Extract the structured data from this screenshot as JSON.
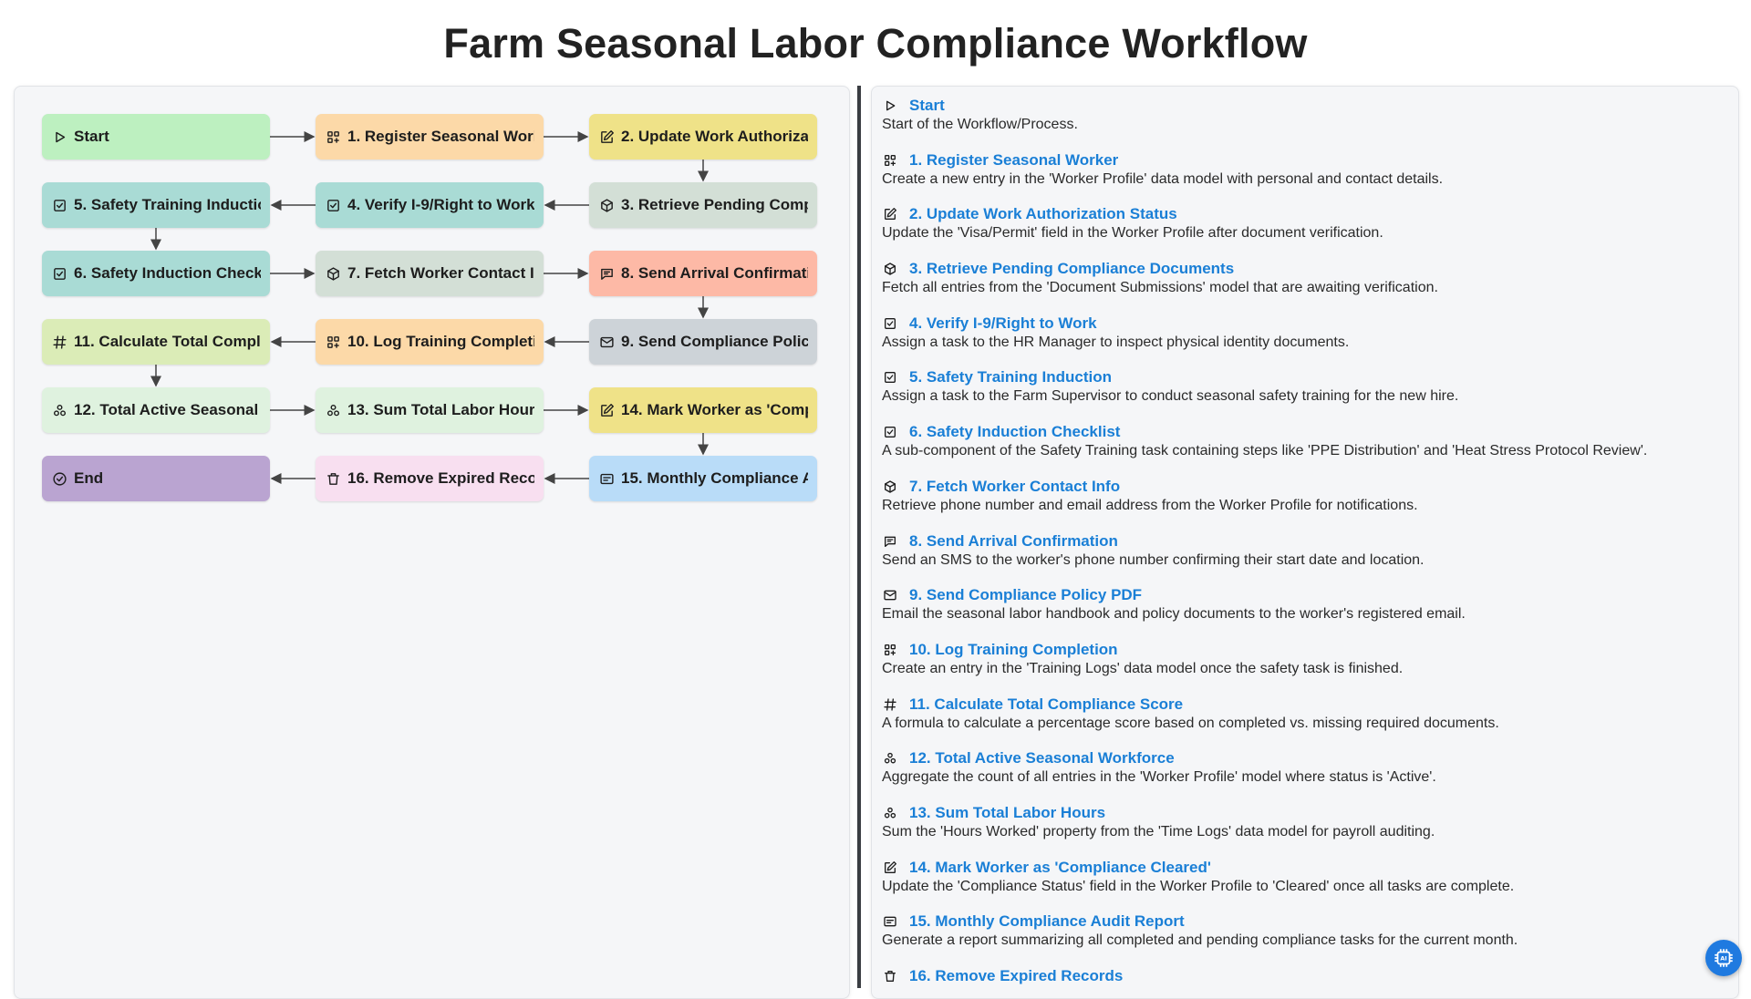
{
  "title": "Farm Seasonal Labor Compliance Workflow",
  "colors": {
    "start": "#bdf0c0",
    "register": "#fcd9a8",
    "update": "#efe288",
    "retrieve": "#d3dfd6",
    "verify": "#a9dbd5",
    "send_sms": "#fdb9a6",
    "send_email": "#cdd3d8",
    "formula": "#dbecb7",
    "aggregate": "#dff2df",
    "report": "#b9dcf8",
    "delete": "#f8dff0",
    "end": "#baa4d1",
    "link": "#1a7fd6",
    "edge": "#444444"
  },
  "nodes": [
    {
      "label": "Start",
      "icon": "play-icon",
      "color": "start"
    },
    {
      "label": "1. Register Seasonal Worker",
      "icon": "grid-icon",
      "color": "register"
    },
    {
      "label": "2. Update Work Authorization Status",
      "icon": "edit-icon",
      "color": "update"
    },
    {
      "label": "3. Retrieve Pending Compliance Documents",
      "icon": "cube-icon",
      "color": "retrieve"
    },
    {
      "label": "4. Verify I-9/Right to Work",
      "icon": "checkbox-icon",
      "color": "verify"
    },
    {
      "label": "5. Safety Training Induction",
      "icon": "checkbox-icon",
      "color": "verify"
    },
    {
      "label": "6. Safety Induction Checklist",
      "icon": "checkbox-icon",
      "color": "verify"
    },
    {
      "label": "7. Fetch Worker Contact Info",
      "icon": "cube-icon",
      "color": "retrieve"
    },
    {
      "label": "8. Send Arrival Confirmation",
      "icon": "chat-icon",
      "color": "send_sms"
    },
    {
      "label": "9. Send Compliance Policy PDF",
      "icon": "mail-icon",
      "color": "send_email"
    },
    {
      "label": "10. Log Training Completion",
      "icon": "grid-icon",
      "color": "register"
    },
    {
      "label": "11. Calculate Total Compliance Score",
      "icon": "hash-icon",
      "color": "formula"
    },
    {
      "label": "12. Total Active Seasonal Workforce",
      "icon": "aggregate-icon",
      "color": "aggregate"
    },
    {
      "label": "13. Sum Total Labor Hours",
      "icon": "aggregate-icon",
      "color": "aggregate"
    },
    {
      "label": "14. Mark Worker as 'Compliance Cleared'",
      "icon": "edit-icon",
      "color": "update"
    },
    {
      "label": "15. Monthly Compliance Audit Report",
      "icon": "report-icon",
      "color": "report"
    },
    {
      "label": "16. Remove Expired Records",
      "icon": "trash-icon",
      "color": "delete"
    },
    {
      "label": "End",
      "icon": "check-circle-icon",
      "color": "end"
    }
  ],
  "steps": [
    {
      "title": "Start",
      "icon": "play-icon",
      "desc": "Start of the Workflow/Process."
    },
    {
      "title": "1. Register Seasonal Worker",
      "icon": "grid-icon",
      "desc": "Create a new entry in the 'Worker Profile' data model with personal and contact details."
    },
    {
      "title": "2. Update Work Authorization Status",
      "icon": "edit-icon",
      "desc": "Update the 'Visa/Permit' field in the Worker Profile after document verification."
    },
    {
      "title": "3. Retrieve Pending Compliance Documents",
      "icon": "cube-icon",
      "desc": "Fetch all entries from the 'Document Submissions' model that are awaiting verification."
    },
    {
      "title": "4. Verify I-9/Right to Work",
      "icon": "checkbox-icon",
      "desc": "Assign a task to the HR Manager to inspect physical identity documents."
    },
    {
      "title": "5. Safety Training Induction",
      "icon": "checkbox-icon",
      "desc": "Assign a task to the Farm Supervisor to conduct seasonal safety training for the new hire."
    },
    {
      "title": "6. Safety Induction Checklist",
      "icon": "checkbox-icon",
      "desc": "A sub-component of the Safety Training task containing steps like 'PPE Distribution' and 'Heat Stress Protocol Review'."
    },
    {
      "title": "7. Fetch Worker Contact Info",
      "icon": "cube-icon",
      "desc": "Retrieve phone number and email address from the Worker Profile for notifications."
    },
    {
      "title": "8. Send Arrival Confirmation",
      "icon": "chat-icon",
      "desc": "Send an SMS to the worker's phone number confirming their start date and location."
    },
    {
      "title": "9. Send Compliance Policy PDF",
      "icon": "mail-icon",
      "desc": "Email the seasonal labor handbook and policy documents to the worker's registered email."
    },
    {
      "title": "10. Log Training Completion",
      "icon": "grid-icon",
      "desc": "Create an entry in the 'Training Logs' data model once the safety task is finished."
    },
    {
      "title": "11. Calculate Total Compliance Score",
      "icon": "hash-icon",
      "desc": "A formula to calculate a percentage score based on completed vs. missing required documents."
    },
    {
      "title": "12. Total Active Seasonal Workforce",
      "icon": "aggregate-icon",
      "desc": "Aggregate the count of all entries in the 'Worker Profile' model where status is 'Active'."
    },
    {
      "title": "13. Sum Total Labor Hours",
      "icon": "aggregate-icon",
      "desc": "Sum the 'Hours Worked' property from the 'Time Logs' data model for payroll auditing."
    },
    {
      "title": "14. Mark Worker as 'Compliance Cleared'",
      "icon": "edit-icon",
      "desc": "Update the 'Compliance Status' field in the Worker Profile to 'Cleared' once all tasks are complete."
    },
    {
      "title": "15. Monthly Compliance Audit Report",
      "icon": "report-icon",
      "desc": "Generate a report summarizing all completed and pending compliance tasks for the current month."
    },
    {
      "title": "16. Remove Expired Records",
      "icon": "trash-icon",
      "desc": ""
    }
  ],
  "fab_icon": "ai-chip-icon"
}
